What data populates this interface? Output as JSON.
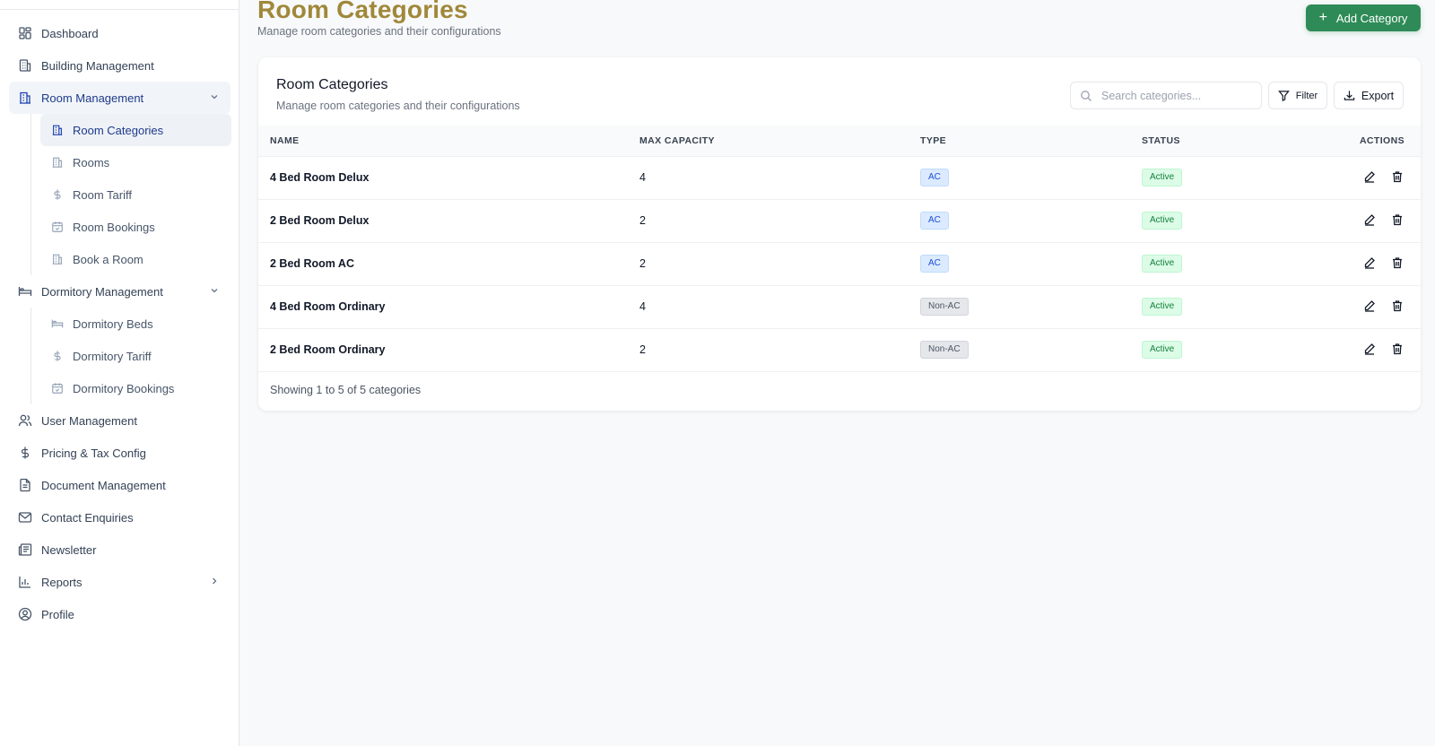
{
  "sidebar": {
    "items": [
      {
        "label": "Dashboard",
        "icon": "dashboard-icon"
      },
      {
        "label": "Building Management",
        "icon": "building-icon"
      },
      {
        "label": "Room Management",
        "icon": "room-building-icon",
        "expanded": true,
        "children": [
          {
            "label": "Room Categories",
            "icon": "room-building-icon",
            "active": true
          },
          {
            "label": "Rooms",
            "icon": "room-building-icon"
          },
          {
            "label": "Room Tariff",
            "icon": "dollar-icon"
          },
          {
            "label": "Room Bookings",
            "icon": "calendar-icon"
          },
          {
            "label": "Book a Room",
            "icon": "room-building-icon"
          }
        ]
      },
      {
        "label": "Dormitory Management",
        "icon": "bed-icon",
        "expanded": true,
        "children": [
          {
            "label": "Dormitory Beds",
            "icon": "bed-icon"
          },
          {
            "label": "Dormitory Tariff",
            "icon": "dollar-icon"
          },
          {
            "label": "Dormitory Bookings",
            "icon": "calendar-icon"
          }
        ]
      },
      {
        "label": "User Management",
        "icon": "users-icon"
      },
      {
        "label": "Pricing & Tax Config",
        "icon": "dollar-icon"
      },
      {
        "label": "Document Management",
        "icon": "document-icon"
      },
      {
        "label": "Contact Enquiries",
        "icon": "mail-icon"
      },
      {
        "label": "Newsletter",
        "icon": "newspaper-icon"
      },
      {
        "label": "Reports",
        "icon": "chart-icon"
      },
      {
        "label": "Profile",
        "icon": "user-circle-icon"
      }
    ]
  },
  "header": {
    "title": "Room Categories",
    "subtitle": "Manage room categories and their configurations",
    "add_button_label": "Add Category"
  },
  "card": {
    "title": "Room Categories",
    "subtitle": "Manage room categories and their configurations",
    "search_placeholder": "Search categories...",
    "filter_label": "Filter",
    "export_label": "Export",
    "columns": [
      "NAME",
      "MAX CAPACITY",
      "TYPE",
      "STATUS",
      "ACTIONS"
    ],
    "rows": [
      {
        "name": "4 Bed Room Delux",
        "capacity": "4",
        "type": "AC",
        "status": "Active"
      },
      {
        "name": "2 Bed Room Delux",
        "capacity": "2",
        "type": "AC",
        "status": "Active"
      },
      {
        "name": "2 Bed Room AC",
        "capacity": "2",
        "type": "AC",
        "status": "Active"
      },
      {
        "name": "4 Bed Room Ordinary",
        "capacity": "4",
        "type": "Non-AC",
        "status": "Active"
      },
      {
        "name": "2 Bed Room Ordinary",
        "capacity": "2",
        "type": "Non-AC",
        "status": "Active"
      }
    ],
    "footer": "Showing 1 to 5 of 5 categories"
  },
  "colors": {
    "title_gold": "#a0883a",
    "primary_green": "#2e8b57",
    "nav_active": "#1e3a8a",
    "badge_ac": "#dbeafe",
    "badge_active": "#dcfce7"
  }
}
